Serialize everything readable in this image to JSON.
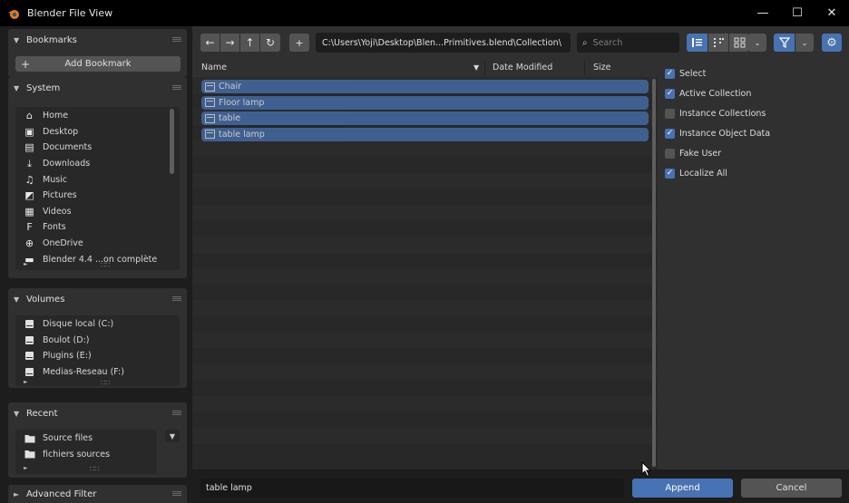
{
  "window": {
    "title": "Blender File View",
    "minimize": "—",
    "maximize": "☐",
    "close": "✕"
  },
  "bookmarks": {
    "title": "Bookmarks",
    "add_label": "Add Bookmark",
    "add_icon": "+"
  },
  "system": {
    "title": "System",
    "items": [
      {
        "label": "Home",
        "icon": "home-icon",
        "glyph": "⌂"
      },
      {
        "label": "Desktop",
        "icon": "desktop-icon",
        "glyph": "▣"
      },
      {
        "label": "Documents",
        "icon": "documents-icon",
        "glyph": "▤"
      },
      {
        "label": "Downloads",
        "icon": "downloads-icon",
        "glyph": "⤓"
      },
      {
        "label": "Music",
        "icon": "music-icon",
        "glyph": "♫"
      },
      {
        "label": "Pictures",
        "icon": "pictures-icon",
        "glyph": "◩"
      },
      {
        "label": "Videos",
        "icon": "videos-icon",
        "glyph": "▦"
      },
      {
        "label": "Fonts",
        "icon": "fonts-icon",
        "glyph": "F"
      },
      {
        "label": "OneDrive",
        "icon": "globe-icon",
        "glyph": "⊕"
      },
      {
        "label": "Blender 4.4 ...on complète",
        "icon": "folder-icon",
        "glyph": "▬"
      }
    ]
  },
  "volumes": {
    "title": "Volumes",
    "items": [
      {
        "label": "Disque local (C:)",
        "icon": "disk-icon"
      },
      {
        "label": "Boulot (D:)",
        "icon": "disk-icon"
      },
      {
        "label": "Plugins (E:)",
        "icon": "disk-icon"
      },
      {
        "label": "Medias-Reseau (F:)",
        "icon": "disk-icon"
      }
    ]
  },
  "recent": {
    "title": "Recent",
    "items": [
      {
        "label": "Source files",
        "icon": "folder-icon"
      },
      {
        "label": "fichiers sources",
        "icon": "folder-icon"
      }
    ]
  },
  "advanced_filter": {
    "title": "Advanced Filter"
  },
  "toolbar": {
    "back": "←",
    "forward": "→",
    "parent": "↑",
    "refresh": "↻",
    "new_folder": "+",
    "path": "C:\\Users\\Yoji\\Desktop\\Blen...Primitives.blend\\Collection\\",
    "search_placeholder": "Search"
  },
  "columns": {
    "name": "Name",
    "date_modified": "Date Modified",
    "size": "Size"
  },
  "files": [
    {
      "name": "Chair"
    },
    {
      "name": "Floor lamp"
    },
    {
      "name": "table"
    },
    {
      "name": "table lamp"
    }
  ],
  "options": [
    {
      "label": "Select",
      "checked": true
    },
    {
      "label": "Active Collection",
      "checked": true
    },
    {
      "label": "Instance Collections",
      "checked": false
    },
    {
      "label": "Instance Object Data",
      "checked": true
    },
    {
      "label": "Fake User",
      "checked": false
    },
    {
      "label": "Localize All",
      "checked": true
    }
  ],
  "bottom": {
    "filename": "table lamp",
    "append_label": "Append",
    "cancel_label": "Cancel"
  },
  "colors": {
    "accent": "#4772b3",
    "panel": "#303030",
    "background": "#1d1d1d"
  }
}
